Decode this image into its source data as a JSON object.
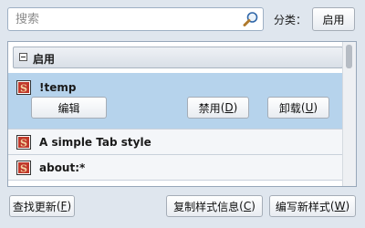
{
  "search": {
    "placeholder": "搜索",
    "value": ""
  },
  "category": {
    "label": "分类：",
    "selected": "启用"
  },
  "list": {
    "group": {
      "label": "启用"
    },
    "items": [
      {
        "name": "!temp",
        "icon": "stylish-s-icon",
        "selected": true,
        "actions": {
          "edit": "编辑",
          "disable_text": "禁用",
          "disable_key": "D",
          "uninstall_text": "卸载",
          "uninstall_key": "U"
        }
      },
      {
        "name": "A simple Tab style",
        "icon": "stylish-s-icon",
        "selected": false
      },
      {
        "name": "about:*",
        "icon": "stylish-s-icon",
        "selected": false
      }
    ]
  },
  "footer": {
    "check_updates_text": "查找更新",
    "check_updates_key": "F",
    "copy_info_text": "复制样式信息",
    "copy_info_key": "C",
    "write_new_text": "编写新样式",
    "write_new_key": "W"
  },
  "colors": {
    "selection": "#b6d3ec",
    "background": "#dfe6ee",
    "icon_red": "#c0392b"
  }
}
